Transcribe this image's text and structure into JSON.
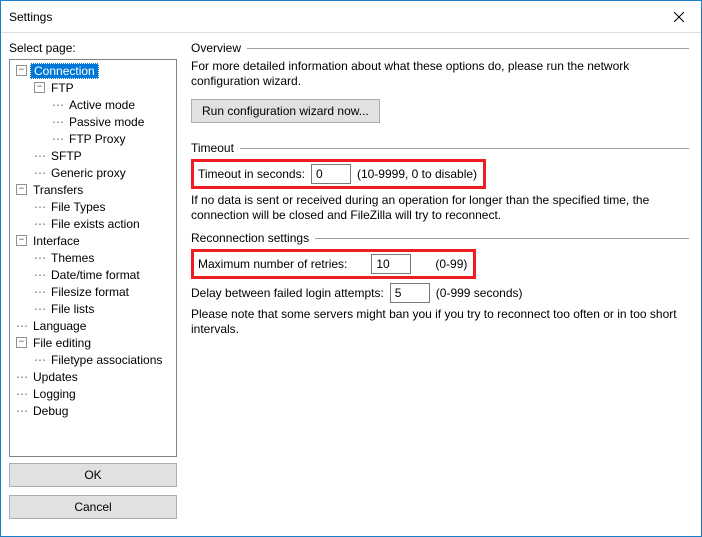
{
  "window": {
    "title": "Settings"
  },
  "left": {
    "label": "Select page:",
    "ok": "OK",
    "cancel": "Cancel"
  },
  "tree": {
    "connection": "Connection",
    "ftp": "FTP",
    "active": "Active mode",
    "passive": "Passive mode",
    "ftpproxy": "FTP Proxy",
    "sftp": "SFTP",
    "genericproxy": "Generic proxy",
    "transfers": "Transfers",
    "filetypes": "File Types",
    "fileexists": "File exists action",
    "interface": "Interface",
    "themes": "Themes",
    "datetime": "Date/time format",
    "filesize": "Filesize format",
    "filelists": "File lists",
    "language": "Language",
    "fileediting": "File editing",
    "filetypeassoc": "Filetype associations",
    "updates": "Updates",
    "logging": "Logging",
    "debug": "Debug"
  },
  "overview": {
    "title": "Overview",
    "text": "For more detailed information about what these options do, please run the network configuration wizard.",
    "button": "Run configuration wizard now..."
  },
  "timeout": {
    "title": "Timeout",
    "label": "Timeout in seconds:",
    "value": "0",
    "hint": "(10-9999, 0 to disable)",
    "desc": "If no data is sent or received during an operation for longer than the specified time, the connection will be closed and FileZilla will try to reconnect."
  },
  "reconnect": {
    "title": "Reconnection settings",
    "retries_label": "Maximum number of retries:",
    "retries_value": "10",
    "retries_hint": "(0-99)",
    "delay_label": "Delay between failed login attempts:",
    "delay_value": "5",
    "delay_hint": "(0-999 seconds)",
    "desc": "Please note that some servers might ban you if you try to reconnect too often or in too short intervals."
  }
}
